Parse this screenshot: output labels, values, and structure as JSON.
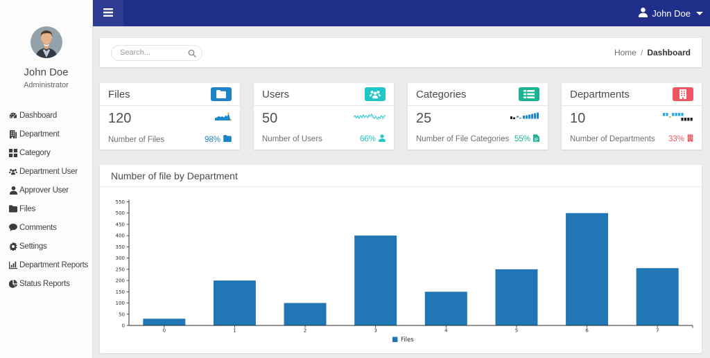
{
  "topnav": {
    "user_name": "John Doe"
  },
  "sidebar": {
    "user": {
      "name": "John Doe",
      "role": "Administrator"
    },
    "items": [
      {
        "label": "Dashboard",
        "icon": "dashboard-icon"
      },
      {
        "label": "Department",
        "icon": "building-icon"
      },
      {
        "label": "Category",
        "icon": "grid-icon"
      },
      {
        "label": "Department User",
        "icon": "users-icon"
      },
      {
        "label": "Approver User",
        "icon": "user-icon"
      },
      {
        "label": "Files",
        "icon": "folder-icon"
      },
      {
        "label": "Comments",
        "icon": "comment-icon"
      },
      {
        "label": "Settings",
        "icon": "gear-icon"
      },
      {
        "label": "Department Reports",
        "icon": "bar-chart-icon"
      },
      {
        "label": "Status Reports",
        "icon": "pie-chart-icon"
      }
    ]
  },
  "toolbar": {
    "search_placeholder": "Search...",
    "breadcrumb": {
      "home": "Home",
      "separator": "/",
      "current": "Dashboard"
    }
  },
  "stat_cards": [
    {
      "title": "Files",
      "value": "120",
      "label": "Number of Files",
      "percent": "98%",
      "color": "#1c84c6",
      "icon": "folder-icon"
    },
    {
      "title": "Users",
      "value": "50",
      "label": "Number of Users",
      "percent": "66%",
      "color": "#23c6c8",
      "icon": "users-icon"
    },
    {
      "title": "Categories",
      "value": "25",
      "label": "Number of File Categories",
      "percent": "55%",
      "color": "#1ab394",
      "icon": "list-icon"
    },
    {
      "title": "Departments",
      "value": "10",
      "label": "Number of Departments",
      "percent": "33%",
      "color": "#ed5565",
      "icon": "building-icon"
    }
  ],
  "chart": {
    "title": "Number of file by Department"
  },
  "chart_data": {
    "type": "bar",
    "title": "Number of file by Department",
    "categories": [
      "0",
      "1",
      "2",
      "3",
      "4",
      "5",
      "6",
      "7"
    ],
    "values": [
      30,
      200,
      100,
      400,
      150,
      250,
      500,
      255
    ],
    "series_name": "Files",
    "xlabel": "",
    "ylabel": "",
    "ylim": [
      0,
      550
    ],
    "ytick_step": 50,
    "bar_color": "#2176b5",
    "grid": false,
    "legend_position": "bottom-center"
  }
}
